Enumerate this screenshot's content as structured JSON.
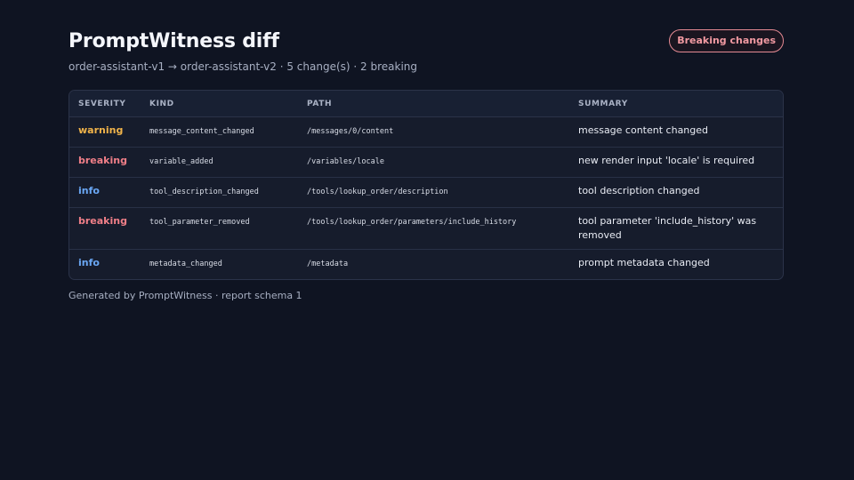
{
  "header": {
    "title": "PromptWitness diff",
    "subtitle": "order-assistant-v1 → order-assistant-v2 · 5 change(s) · 2 breaking",
    "badge": "Breaking changes"
  },
  "table": {
    "columns": [
      "SEVERITY",
      "KIND",
      "PATH",
      "SUMMARY"
    ],
    "rows": [
      {
        "severity": "warning",
        "kind": "message_content_changed",
        "path": "/messages/0/content",
        "summary": "message content changed"
      },
      {
        "severity": "breaking",
        "kind": "variable_added",
        "path": "/variables/locale",
        "summary": "new render input 'locale' is required"
      },
      {
        "severity": "info",
        "kind": "tool_description_changed",
        "path": "/tools/lookup_order/description",
        "summary": "tool description changed"
      },
      {
        "severity": "breaking",
        "kind": "tool_parameter_removed",
        "path": "/tools/lookup_order/parameters/include_history",
        "summary": "tool parameter 'include_history' was removed"
      },
      {
        "severity": "info",
        "kind": "metadata_changed",
        "path": "/metadata",
        "summary": "prompt metadata changed"
      }
    ]
  },
  "footer": {
    "text": "Generated by PromptWitness · report schema 1"
  },
  "colors": {
    "warning": "#f0b34a",
    "breaking": "#f07f88",
    "info": "#6aa7f4"
  }
}
